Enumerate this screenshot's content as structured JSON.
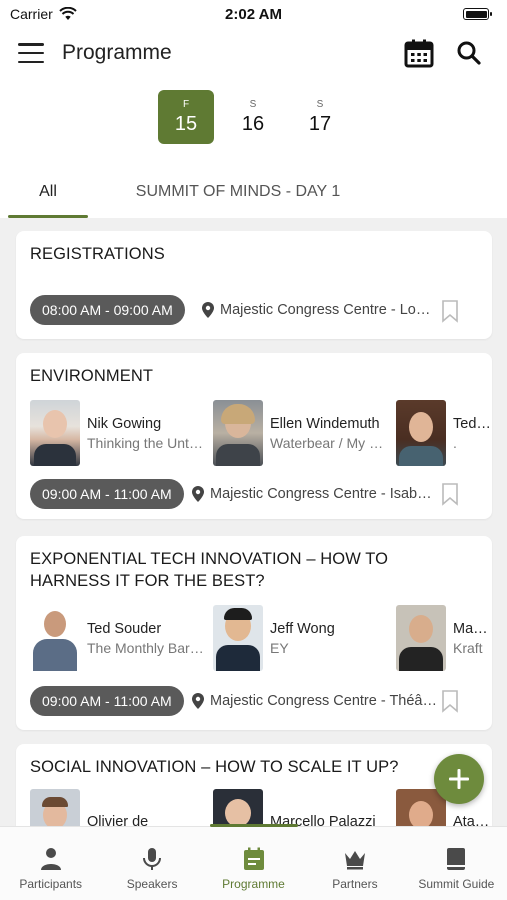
{
  "status_bar": {
    "carrier": "Carrier",
    "time": "2:02 AM"
  },
  "header": {
    "title": "Programme"
  },
  "dates": [
    {
      "dow": "F",
      "day": "15",
      "active": true
    },
    {
      "dow": "S",
      "day": "16",
      "active": false
    },
    {
      "dow": "S",
      "day": "17",
      "active": false
    }
  ],
  "tabs": [
    {
      "label": "All",
      "active": true
    },
    {
      "label": "SUMMIT OF MINDS - DAY 1",
      "active": false
    }
  ],
  "sessions": [
    {
      "title": "REGISTRATIONS",
      "time": "08:00 AM - 09:00 AM",
      "location": "Majestic Congress Centre - Lobby"
    },
    {
      "title": "ENVIRONMENT",
      "time": "09:00 AM - 11:00 AM",
      "location": "Majestic Congress Centre - Isabella Hall",
      "speakers": [
        {
          "name": "Nik Gowing",
          "org": "Thinking the Unthinkable"
        },
        {
          "name": "Ellen Windemuth",
          "org": "Waterbear / My Octopus Teacher"
        },
        {
          "name": "Ted Souder",
          "org": "."
        }
      ]
    },
    {
      "title": "EXPONENTIAL TECH INNOVATION – HOW TO HARNESS IT FOR THE BEST?",
      "time": "09:00 AM - 11:00 AM",
      "location": "Majestic Congress Centre - Théâtre",
      "speakers": [
        {
          "name": "Ted Souder",
          "org": "The Monthly Barometer"
        },
        {
          "name": "Jeff Wong",
          "org": "EY"
        },
        {
          "name": "Martin",
          "org": "Kraft"
        }
      ]
    },
    {
      "title": "SOCIAL INNOVATION – HOW TO SCALE IT UP?",
      "speakers": [
        {
          "name": "Olivier de"
        },
        {
          "name": "Marcello Palazzi"
        },
        {
          "name": "Atalay"
        }
      ]
    }
  ],
  "bottom_nav": [
    {
      "label": "Participants",
      "icon": "person-icon"
    },
    {
      "label": "Speakers",
      "icon": "microphone-icon"
    },
    {
      "label": "Programme",
      "icon": "calendar-icon",
      "active": true
    },
    {
      "label": "Partners",
      "icon": "crown-icon"
    },
    {
      "label": "Summit Guide",
      "icon": "book-icon"
    }
  ],
  "colors": {
    "accent": "#5f7a33",
    "fab": "#6e8b3d",
    "pill": "#5a5a5a"
  }
}
